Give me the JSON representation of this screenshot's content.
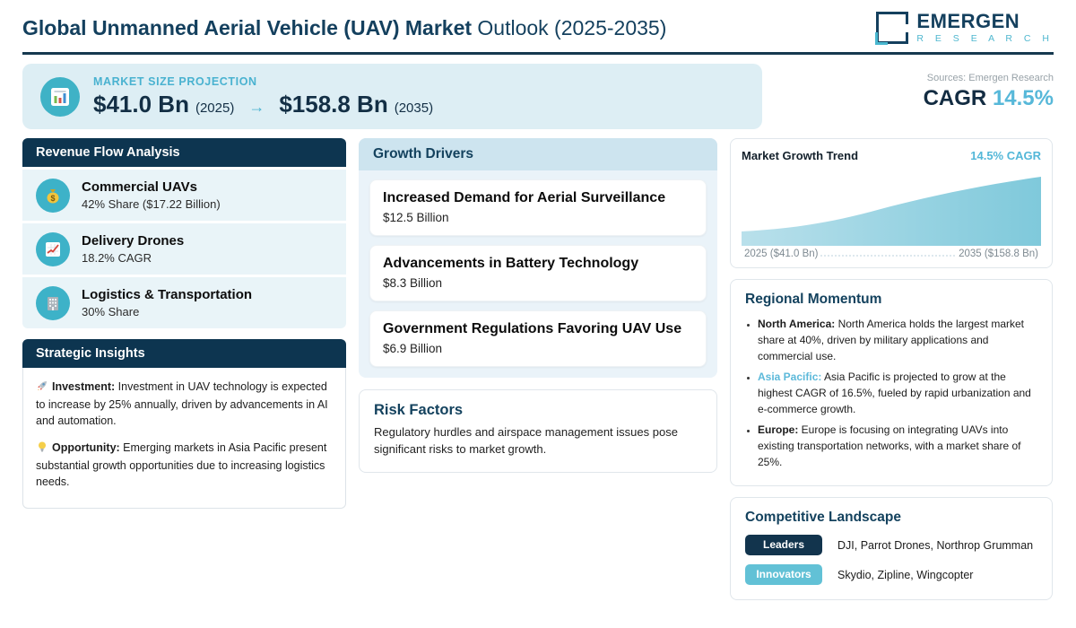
{
  "header": {
    "title_bold": "Global Unmanned Aerial Vehicle (UAV) Market",
    "title_rest": " Outlook (2025-2035)",
    "logo_name": "EMERGEN",
    "logo_sub": "R E S E A R C H"
  },
  "banner": {
    "icon": "bar-chart-icon",
    "label": "MARKET SIZE PROJECTION",
    "start_value": "$41.0 Bn",
    "start_year": "(2025)",
    "arrow": "→",
    "end_value": "$158.8 Bn",
    "end_year": "(2035)",
    "sources": "Sources: Emergen Research",
    "cagr_label": "CAGR",
    "cagr_value": "14.5%"
  },
  "revenue": {
    "title": "Revenue Flow Analysis",
    "items": [
      {
        "icon": "money-bag-icon",
        "title": "Commercial UAVs",
        "subtitle": "42% Share ($17.22 Billion)"
      },
      {
        "icon": "chart-up-icon",
        "title": "Delivery Drones",
        "subtitle": "18.2% CAGR"
      },
      {
        "icon": "building-icon",
        "title": "Logistics & Transportation",
        "subtitle": "30% Share"
      }
    ]
  },
  "strategic": {
    "title": "Strategic Insights",
    "items": [
      {
        "icon": "rocket-icon",
        "lead": "Investment:",
        "text": "Investment in UAV technology is expected to increase by 25% annually, driven by advancements in AI and automation."
      },
      {
        "icon": "bulb-icon",
        "lead": "Opportunity:",
        "text": "Emerging markets in Asia Pacific present substantial growth opportunities due to increasing logistics needs."
      }
    ]
  },
  "growth": {
    "title": "Growth Drivers",
    "items": [
      {
        "title": "Increased Demand for Aerial Surveillance",
        "value": "$12.5 Billion"
      },
      {
        "title": "Advancements in Battery Technology",
        "value": "$8.3 Billion"
      },
      {
        "title": "Government Regulations Favoring UAV Use",
        "value": "$6.9 Billion"
      }
    ]
  },
  "risk": {
    "title": "Risk Factors",
    "text": "Regulatory hurdles and airspace management issues pose significant risks to market growth."
  },
  "trend": {
    "title": "Market Growth Trend",
    "cagr": "14.5% CAGR",
    "start_label": "2025 ($41.0 Bn)",
    "end_label": "2035 ($158.8 Bn)"
  },
  "regional": {
    "title": "Regional Momentum",
    "items": [
      {
        "lead": "North America:",
        "text": " North America holds the largest market share at 40%, driven by military applications and commercial use."
      },
      {
        "lead": "Asia Pacific:",
        "text": " Asia Pacific is projected to grow at the highest CAGR of 16.5%, fueled by rapid urbanization and e-commerce growth."
      },
      {
        "lead": "Europe:",
        "text": " Europe is focusing on integrating UAVs into existing transportation networks, with a market share of 25%."
      }
    ]
  },
  "competitive": {
    "title": "Competitive Landscape",
    "rows": [
      {
        "badge": "Leaders",
        "companies": "DJI, Parrot Drones, Northrop Grumman"
      },
      {
        "badge": "Innovators",
        "companies": "Skydio, Zipline, Wingcopter"
      }
    ]
  },
  "colors": {
    "navy": "#0d3550",
    "dark_text_navy": "#14405e",
    "teal_accent": "#3fb2c6",
    "light_blue_accent": "#57b8d9",
    "banner_bg": "#ddeef4",
    "item_bg": "#e9f4f8",
    "growth_section_bg": "#eaf3f9",
    "growth_header_bg": "#cde4ef"
  },
  "chart_data": {
    "type": "area",
    "title": "Market Growth Trend",
    "x": [
      2025,
      2035
    ],
    "values": [
      41.0,
      158.8
    ],
    "unit": "USD Billion",
    "cagr_percent": 14.5,
    "xlabel": "",
    "ylabel": "",
    "x_tick_labels": [
      "2025 ($41.0 Bn)",
      "2035 ($158.8 Bn)"
    ],
    "legend": "none",
    "grid": false,
    "curve": "smooth-exponential",
    "fill_gradient": [
      "#b9e0eb",
      "#7fc9db"
    ]
  }
}
